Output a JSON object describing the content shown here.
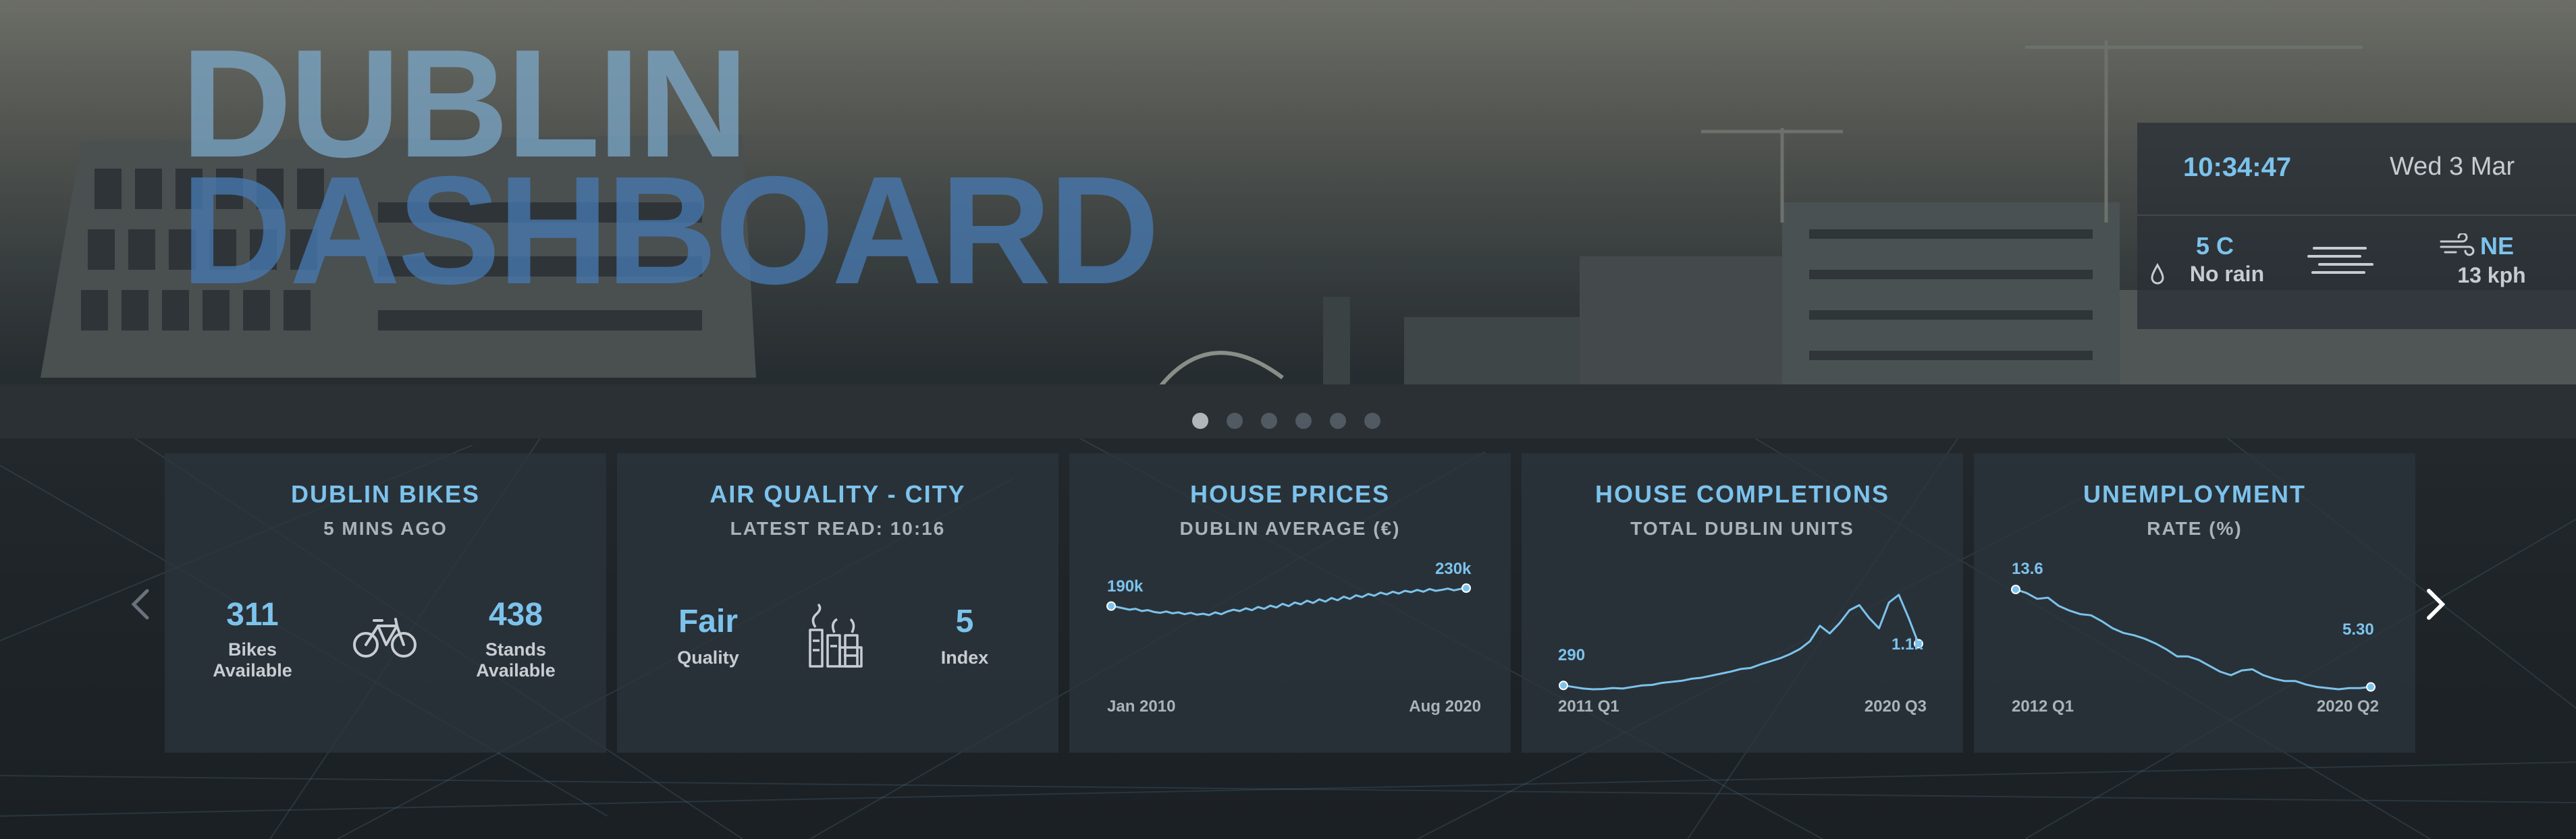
{
  "header": {
    "title_line1": "DUBLIN",
    "title_line2": "DASHBOARD"
  },
  "widget": {
    "time": "10:34:47",
    "date": "Wed 3 Mar",
    "temperature": "5 C",
    "rain": "No rain",
    "wind_direction": "NE",
    "wind_speed": "13 kph",
    "weather_icon": "fog-icon"
  },
  "carousel": {
    "dot_count": 6,
    "active_index": 0
  },
  "cards": {
    "bikes": {
      "title": "DUBLIN BIKES",
      "subtitle": "5 MINS AGO",
      "bikes_value": "311",
      "bikes_label_1": "Bikes",
      "bikes_label_2": "Available",
      "stands_value": "438",
      "stands_label_1": "Stands",
      "stands_label_2": "Available",
      "icon": "bicycle-icon"
    },
    "air": {
      "title": "AIR QUALITY - CITY",
      "subtitle": "LATEST READ: 10:16",
      "quality_value": "Fair",
      "quality_label": "Quality",
      "index_value": "5",
      "index_label": "Index",
      "icon": "factory-icon"
    },
    "house_prices": {
      "title": "HOUSE PRICES",
      "subtitle": "DUBLIN AVERAGE (€)",
      "start_label": "Jan 2010",
      "end_label": "Aug 2020",
      "start_value": "190k",
      "end_value": "230k"
    },
    "completions": {
      "title": "HOUSE COMPLETIONS",
      "subtitle": "TOTAL DUBLIN UNITS",
      "start_label": "2011 Q1",
      "end_label": "2020 Q3",
      "start_value": "290",
      "end_value": "1.1k"
    },
    "unemployment": {
      "title": "UNEMPLOYMENT",
      "subtitle": "RATE (%)",
      "start_label": "2012 Q1",
      "end_label": "2020 Q2",
      "start_value": "13.6",
      "end_value": "5.30"
    }
  },
  "colors": {
    "accent": "#7cc3ec",
    "card_bg": "#2c343c",
    "muted_text": "#aab2ba"
  },
  "chart_data": [
    {
      "type": "line",
      "title": "HOUSE PRICES",
      "subtitle": "DUBLIN AVERAGE (€)",
      "x_start": "Jan 2010",
      "x_end": "Aug 2020",
      "series": [
        {
          "values": [
            190,
            188,
            185,
            182,
            184,
            179,
            181,
            177,
            175,
            178,
            174,
            176,
            172,
            175,
            171,
            173,
            170,
            176,
            172,
            178,
            182,
            179,
            185,
            181,
            188,
            184,
            191,
            187,
            195,
            190,
            198,
            194,
            202,
            197,
            205,
            200,
            208,
            203,
            211,
            206,
            214,
            210,
            217,
            213,
            220,
            216,
            222,
            218,
            224,
            221,
            226,
            222,
            228,
            224,
            226,
            229,
            225,
            228,
            230
          ]
        }
      ]
    },
    {
      "type": "line",
      "title": "HOUSE COMPLETIONS",
      "subtitle": "TOTAL DUBLIN UNITS",
      "x_start": "2011 Q1",
      "x_end": "2020 Q3",
      "series": [
        {
          "values": [
            290,
            260,
            230,
            215,
            220,
            240,
            230,
            260,
            290,
            300,
            340,
            360,
            380,
            420,
            440,
            480,
            520,
            560,
            610,
            630,
            700,
            760,
            820,
            900,
            1000,
            1150,
            1450,
            1300,
            1500,
            1750,
            1850,
            1600,
            1400,
            1900,
            2050,
            1600,
            1100
          ]
        }
      ]
    },
    {
      "type": "line",
      "title": "UNEMPLOYMENT",
      "subtitle": "RATE (%)",
      "x_start": "2012 Q1",
      "x_end": "2020 Q2",
      "series": [
        {
          "values": [
            13.6,
            13.3,
            12.8,
            12.9,
            12.2,
            11.8,
            11.5,
            11.4,
            10.9,
            10.3,
            9.9,
            9.7,
            9.4,
            9.0,
            8.5,
            7.9,
            7.9,
            7.6,
            7.1,
            6.6,
            6.3,
            6.7,
            6.8,
            6.3,
            6.0,
            5.8,
            5.8,
            5.5,
            5.3,
            5.2,
            5.1,
            5.2,
            5.2,
            5.3
          ]
        }
      ]
    }
  ]
}
